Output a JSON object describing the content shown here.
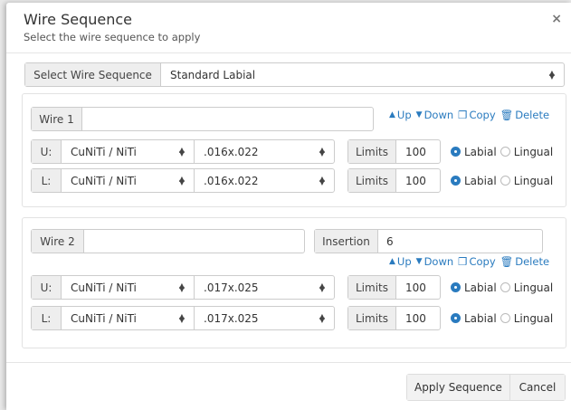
{
  "dialog": {
    "title": "Wire Sequence",
    "subtitle": "Select the wire sequence to apply",
    "close_glyph": "×"
  },
  "sequence_select": {
    "label": "Select Wire Sequence",
    "value": "Standard Labial"
  },
  "actions": {
    "up": "Up",
    "down": "Down",
    "copy": "Copy",
    "delete": "Delete"
  },
  "wires": [
    {
      "label": "Wire 1",
      "name_value": "",
      "rows": [
        {
          "arch": "U:",
          "material": "CuNiTi / NiTi",
          "size": ".016x.022",
          "limits_label": "Limits",
          "limits": "100",
          "labial": "Labial",
          "lingual": "Lingual",
          "selected": "labial"
        },
        {
          "arch": "L:",
          "material": "CuNiTi / NiTi",
          "size": ".016x.022",
          "limits_label": "Limits",
          "limits": "100",
          "labial": "Labial",
          "lingual": "Lingual",
          "selected": "labial"
        }
      ]
    },
    {
      "label": "Wire 2",
      "name_value": "",
      "insertion_label": "Insertion",
      "insertion_value": "6",
      "rows": [
        {
          "arch": "U:",
          "material": "CuNiTi / NiTi",
          "size": ".017x.025",
          "limits_label": "Limits",
          "limits": "100",
          "labial": "Labial",
          "lingual": "Lingual",
          "selected": "labial"
        },
        {
          "arch": "L:",
          "material": "CuNiTi / NiTi",
          "size": ".017x.025",
          "limits_label": "Limits",
          "limits": "100",
          "labial": "Labial",
          "lingual": "Lingual",
          "selected": "labial"
        }
      ]
    }
  ],
  "footer": {
    "apply": "Apply Sequence",
    "cancel": "Cancel"
  },
  "colors": {
    "accent": "#2a7bbf",
    "addon_bg": "#eeeeee"
  }
}
